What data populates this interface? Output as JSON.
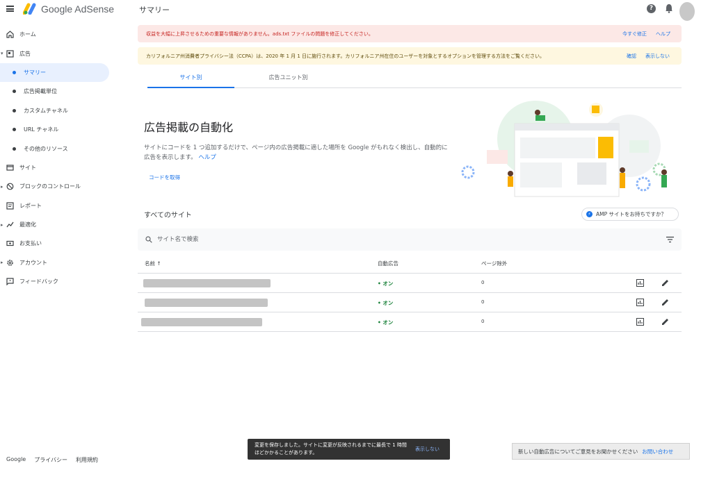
{
  "header": {
    "brand": "Google AdSense",
    "page_title": "サマリー",
    "help_icon": "help-icon",
    "notifications_icon": "bell-icon"
  },
  "sidebar": {
    "items": [
      {
        "label": "ホーム",
        "icon": "home-icon"
      },
      {
        "label": "広告",
        "icon": "ads-icon",
        "expanded": true
      },
      {
        "label": "サマリー",
        "sub": true,
        "active": true
      },
      {
        "label": "広告掲載単位",
        "sub": true
      },
      {
        "label": "カスタムチャネル",
        "sub": true
      },
      {
        "label": "URL チャネル",
        "sub": true
      },
      {
        "label": "その他のリソース",
        "sub": true
      },
      {
        "label": "サイト",
        "icon": "sites-icon"
      },
      {
        "label": "ブロックのコントロール",
        "icon": "block-icon",
        "expandable": true
      },
      {
        "label": "レポート",
        "icon": "reports-icon"
      },
      {
        "label": "最適化",
        "icon": "optimization-icon",
        "expandable": true
      },
      {
        "label": "お支払い",
        "icon": "payments-icon"
      },
      {
        "label": "アカウント",
        "icon": "account-icon",
        "expandable": true
      },
      {
        "label": "フィードバック",
        "icon": "feedback-icon"
      }
    ]
  },
  "footer": {
    "google": "Google",
    "privacy": "プライバシー",
    "terms": "利用規約"
  },
  "alerts": {
    "red": {
      "message": "収益を大幅に上昇させるための重要な情報がありません。ads.txt ファイルの問題を修正してください。",
      "action_fix": "今すぐ修正",
      "action_help": "ヘルプ"
    },
    "yellow": {
      "message": "カリフォルニア州消費者プライバシー法（CCPA）は、2020 年 1 月 1 日に施行されます。カリフォルニア州在住のユーザーを対象とするオプションを管理する方法をご覧ください。",
      "action_confirm": "確認",
      "action_hide": "表示しない"
    },
    "accent_red": "#fce8e6",
    "accent_yellow": "#fef7e0"
  },
  "tabs": [
    {
      "label": "サイト別",
      "active": true
    },
    {
      "label": "広告ユニット別",
      "active": false
    }
  ],
  "hero": {
    "title": "広告掲載の自動化",
    "description": "サイトにコードを 1 つ追加するだけで、ページ内の広告掲載に適した場所を Google がもれなく検出し、自動的に広告を表示します。",
    "help_link": "ヘルプ",
    "get_code": "コードを取得"
  },
  "sites": {
    "title": "すべてのサイト",
    "amp_button": "AMP サイトをお持ちですか？",
    "search_placeholder": "サイト名で検索",
    "columns": {
      "name": "名前",
      "sort_arrow": "↑",
      "auto_ads": "自動広告",
      "page_exclusions": "ページ除外"
    },
    "rows": [
      {
        "status": "オン",
        "pages": "0",
        "bar_fraction": 0.93
      },
      {
        "status": "オン",
        "pages": "0",
        "bar_fraction": 0.95
      },
      {
        "status": "オン",
        "pages": "0",
        "bar_fraction": 0.88
      }
    ]
  },
  "snackbar": {
    "message": "変更を保存しました。サイトに変更が反映されるまでに最長で 1 時間ほどかかることがあります。",
    "action": "表示しない"
  },
  "feedback": {
    "message": "新しい自動広告についてご意見をお聞かせください",
    "link": "お問い合わせ"
  }
}
